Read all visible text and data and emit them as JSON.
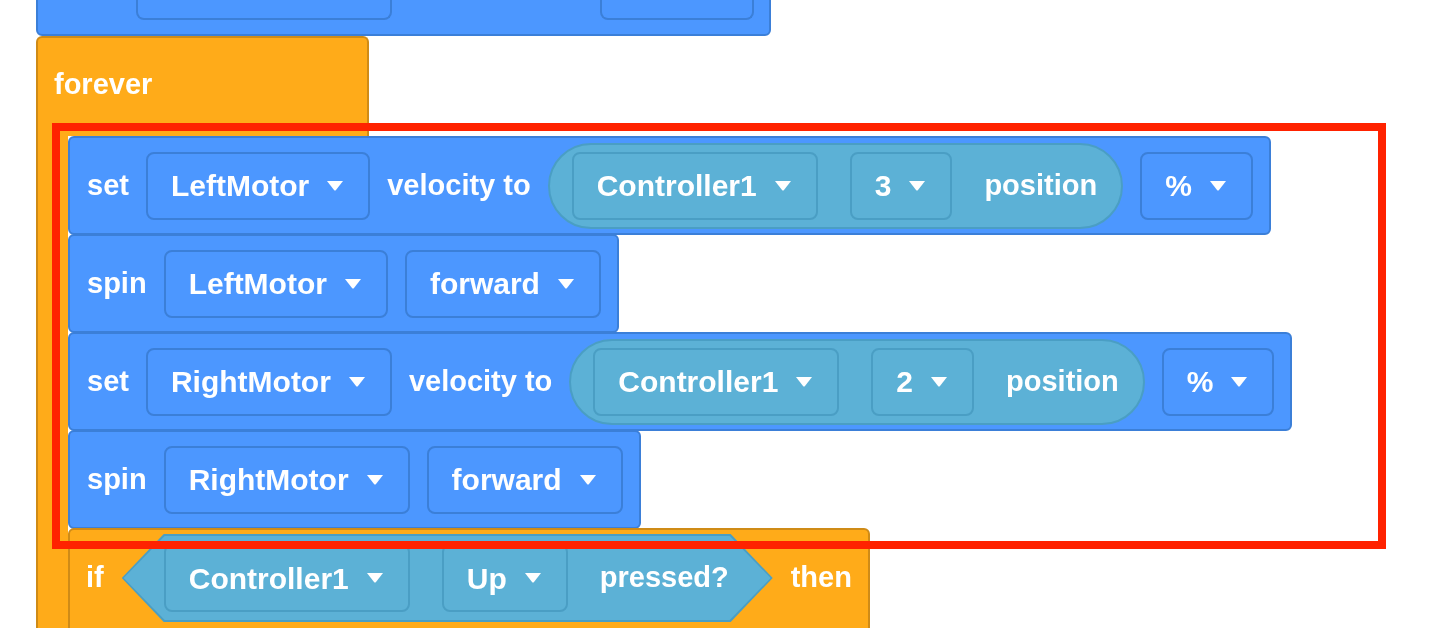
{
  "forever": {
    "label": "forever",
    "blocks": [
      {
        "kind": "statement",
        "parts": [
          {
            "kind": "label",
            "text": "set"
          },
          {
            "kind": "dropdown",
            "text": "LeftMotor"
          },
          {
            "kind": "label",
            "text": "velocity to"
          },
          {
            "kind": "reporter",
            "parts": [
              {
                "kind": "dropdown",
                "text": "Controller1"
              },
              {
                "kind": "dropdown",
                "text": "3"
              },
              {
                "kind": "label",
                "text": "position"
              }
            ]
          },
          {
            "kind": "dropdown",
            "text": "%"
          }
        ]
      },
      {
        "kind": "statement",
        "parts": [
          {
            "kind": "label",
            "text": "spin"
          },
          {
            "kind": "dropdown",
            "text": "LeftMotor"
          },
          {
            "kind": "dropdown",
            "text": "forward"
          }
        ]
      },
      {
        "kind": "statement",
        "parts": [
          {
            "kind": "label",
            "text": "set"
          },
          {
            "kind": "dropdown",
            "text": "RightMotor"
          },
          {
            "kind": "label",
            "text": "velocity to"
          },
          {
            "kind": "reporter",
            "parts": [
              {
                "kind": "dropdown",
                "text": "Controller1"
              },
              {
                "kind": "dropdown",
                "text": "2"
              },
              {
                "kind": "label",
                "text": "position"
              }
            ]
          },
          {
            "kind": "dropdown",
            "text": "%"
          }
        ]
      },
      {
        "kind": "statement",
        "parts": [
          {
            "kind": "label",
            "text": "spin"
          },
          {
            "kind": "dropdown",
            "text": "RightMotor"
          },
          {
            "kind": "dropdown",
            "text": "forward"
          }
        ]
      },
      {
        "kind": "if",
        "parts": [
          {
            "kind": "label",
            "text": "if"
          },
          {
            "kind": "boolean",
            "parts": [
              {
                "kind": "dropdown",
                "text": "Controller1"
              },
              {
                "kind": "dropdown",
                "text": "Up"
              },
              {
                "kind": "label",
                "text": "pressed?"
              }
            ]
          },
          {
            "kind": "label",
            "text": "then"
          }
        ]
      }
    ]
  }
}
